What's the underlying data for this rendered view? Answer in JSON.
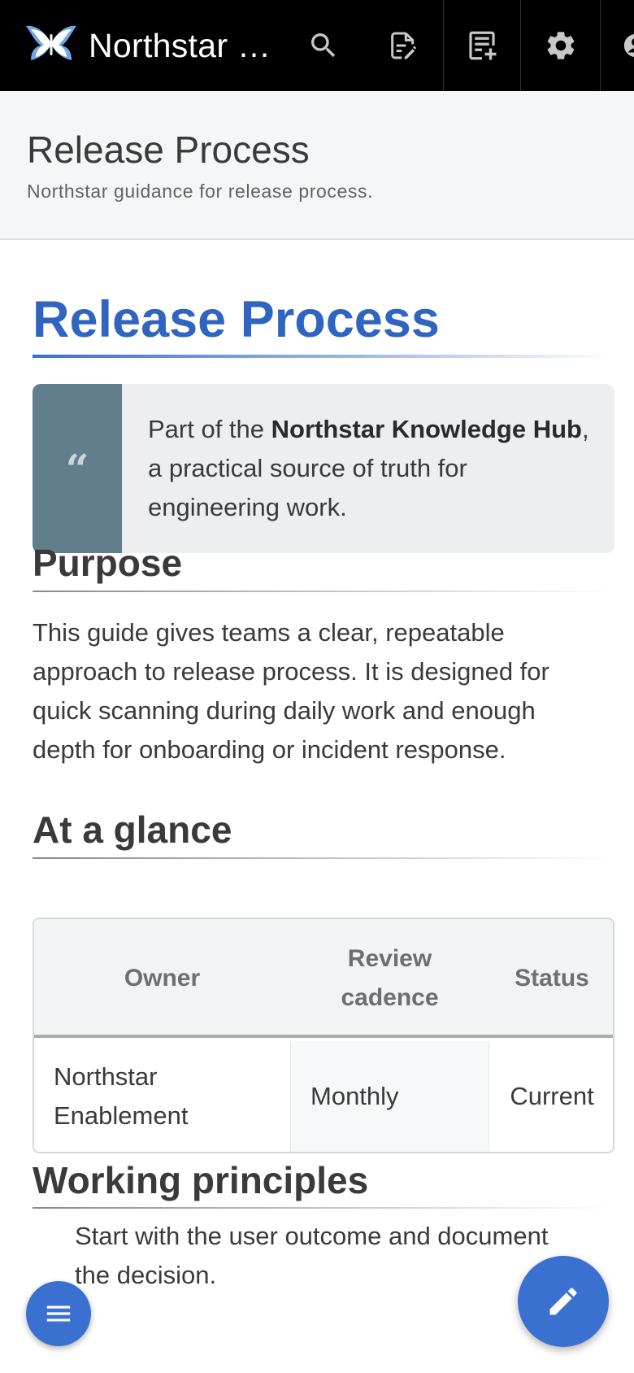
{
  "topbar": {
    "brand": "Northstar …",
    "icons": [
      "logo-icon",
      "search-icon",
      "edit-page-icon",
      "new-page-icon",
      "gear-icon",
      "user-icon"
    ]
  },
  "header": {
    "title": "Release Process",
    "subtitle": "Northstar guidance for release process."
  },
  "article": {
    "h1": "Release Process",
    "quote": {
      "icon": "quote-icon",
      "prefix": "Part of the ",
      "bold": "Northstar Knowledge Hub",
      "suffix": ", a practical source of truth for engineering work."
    },
    "purpose": {
      "heading": "Purpose",
      "text": "This guide gives teams a clear, repeatable approach to release process. It is designed for quick scanning during daily work and enough depth for onboarding or incident response."
    },
    "glance": {
      "heading": "At a glance",
      "columns": [
        "Owner",
        "Review cadence",
        "Status"
      ],
      "rows": [
        [
          "Northstar Enablement",
          "Monthly",
          "Current"
        ]
      ]
    },
    "principles": {
      "heading": "Working principles",
      "first_item": "Start with the user outcome and document the decision."
    }
  },
  "fabs": {
    "menu": "menu-icon",
    "edit": "pencil-icon"
  },
  "colors": {
    "accent": "#2f64c0",
    "fab": "#3a70d0",
    "quote_bar": "#627d8c",
    "topbar": "#000000"
  }
}
